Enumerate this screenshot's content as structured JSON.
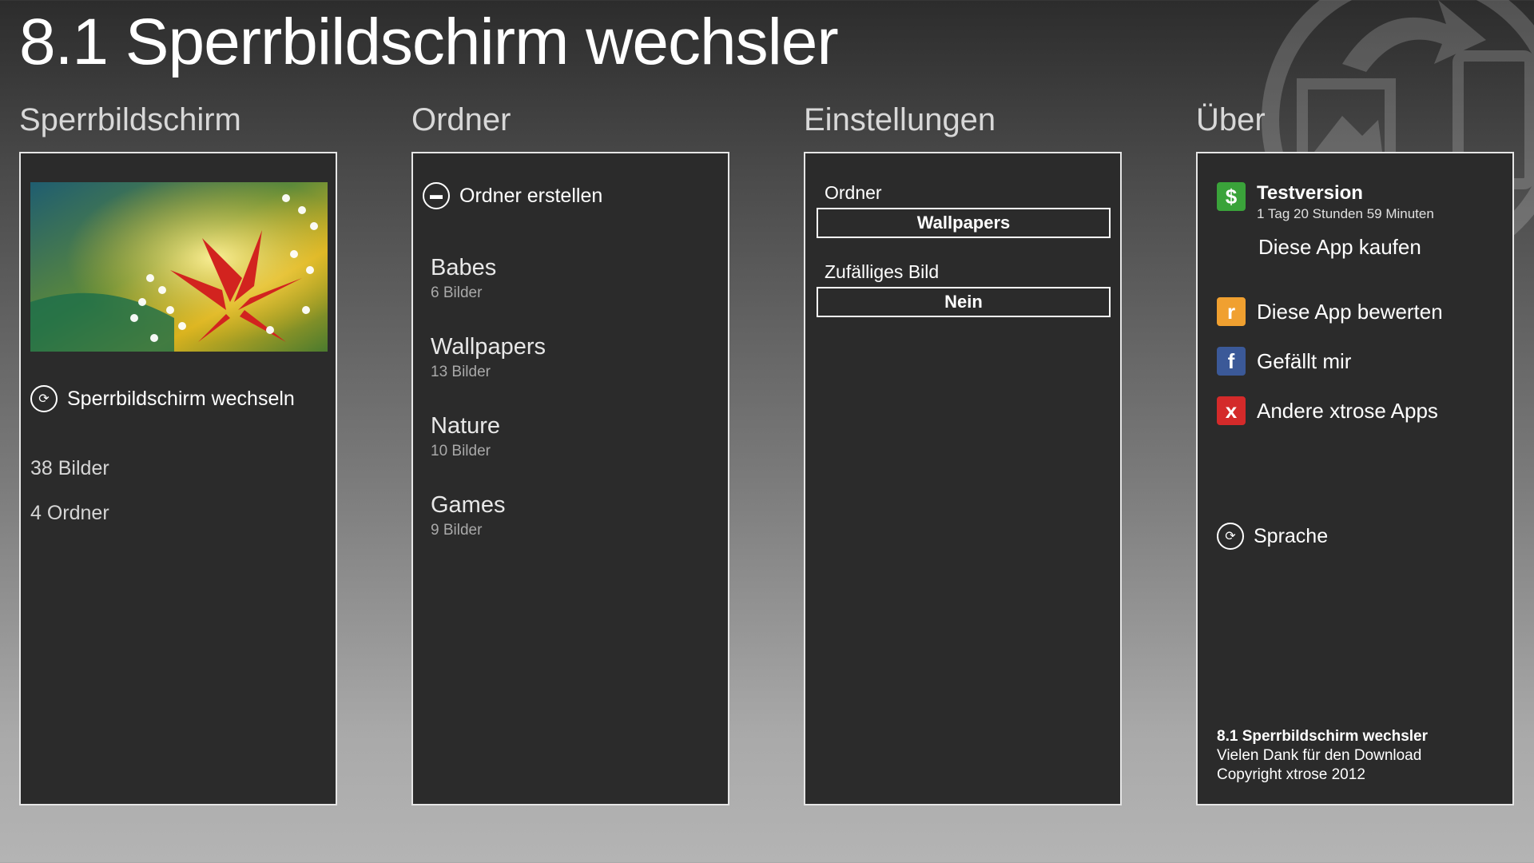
{
  "app": {
    "title": "8.1 Sperrbildschirm wechsler"
  },
  "sections": {
    "lockscreen": {
      "title": "Sperrbildschirm",
      "change_label": "Sperrbildschirm wechseln",
      "images_count": "38 Bilder",
      "folders_count": "4 Ordner"
    },
    "folders": {
      "title": "Ordner",
      "create_label": "Ordner erstellen",
      "items": [
        {
          "name": "Babes",
          "count": "6 Bilder"
        },
        {
          "name": "Wallpapers",
          "count": "13 Bilder"
        },
        {
          "name": "Nature",
          "count": "10 Bilder"
        },
        {
          "name": "Games",
          "count": "9 Bilder"
        }
      ]
    },
    "settings": {
      "title": "Einstellungen",
      "folder_label": "Ordner",
      "folder_value": "Wallpapers",
      "random_label": "Zufälliges Bild",
      "random_value": "Nein"
    },
    "about": {
      "title": "Über",
      "trial_title": "Testversion",
      "trial_time": "1 Tag 20 Stunden 59 Minuten",
      "buy_label": "Diese App kaufen",
      "rate_label": "Diese App bewerten",
      "like_label": "Gefällt mir",
      "other_apps_label": "Andere xtrose Apps",
      "language_label": "Sprache",
      "footer_title": "8.1 Sperrbildschirm wechsler",
      "footer_thanks": "Vielen Dank für den Download",
      "footer_copyright": "Copyright xtrose 2012"
    }
  },
  "icons": {
    "dollar": "$",
    "rate": "r",
    "facebook": "f",
    "xtrose": "x"
  },
  "colors": {
    "panel_bg": "#2b2b2b",
    "dollar_green": "#3aa33a",
    "rate_orange": "#f0a030",
    "facebook_blue": "#3b5998",
    "xtrose_red": "#d42a2a"
  }
}
